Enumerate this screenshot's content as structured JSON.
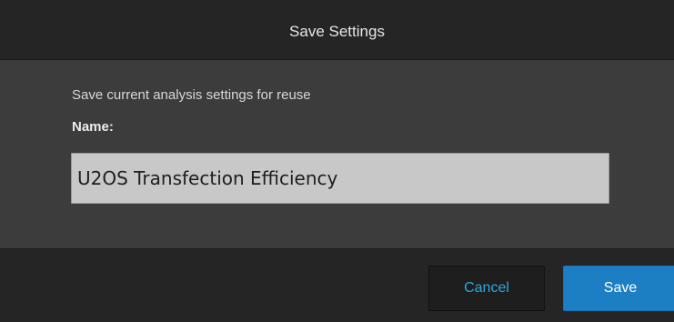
{
  "dialog": {
    "title": "Save Settings",
    "description": "Save current analysis settings for reuse",
    "name_label": "Name:",
    "name_value": "U2OS Transfection Efficiency",
    "name_placeholder": ""
  },
  "buttons": {
    "cancel_label": "Cancel",
    "save_label": "Save"
  },
  "colors": {
    "title_bar_bg": "#252525",
    "body_bg": "#3c3c3c",
    "input_bg": "#c8c8c8",
    "cancel_text": "#2ca8dc",
    "save_bg": "#1d7fc3"
  }
}
